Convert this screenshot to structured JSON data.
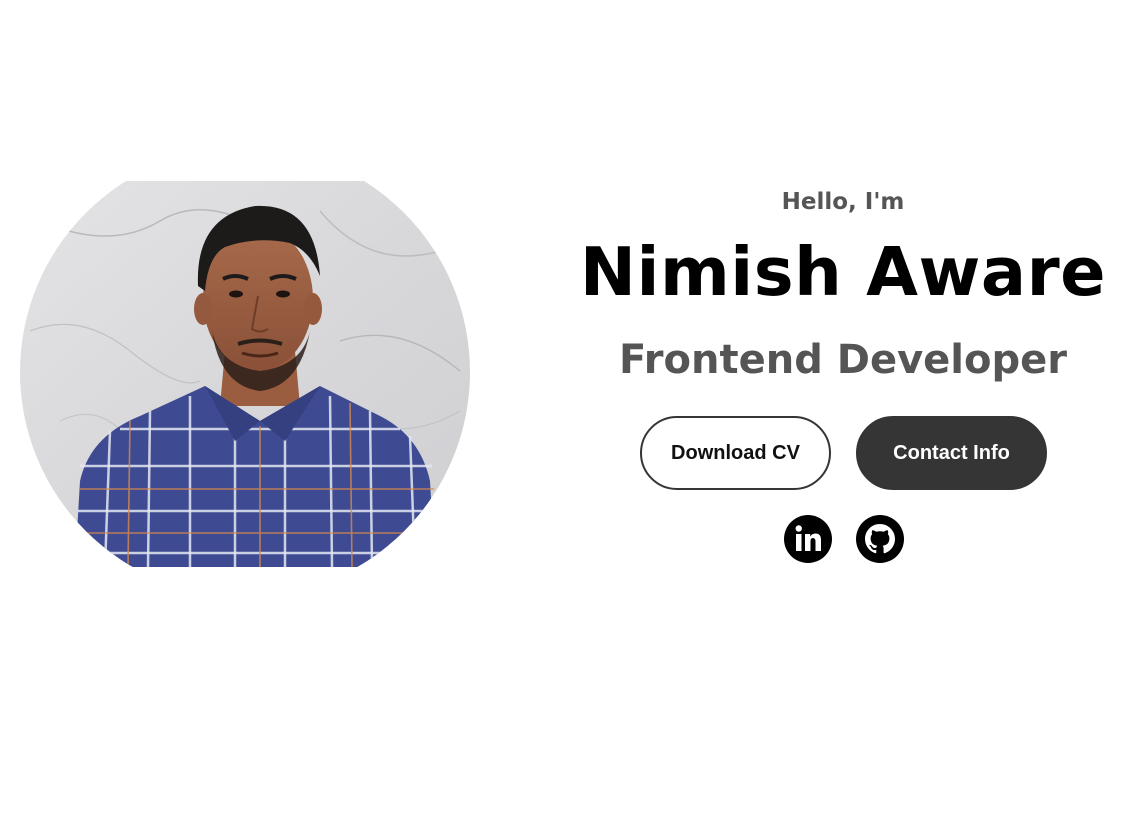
{
  "profile": {
    "image_alt": "profile picture"
  },
  "intro": {
    "greeting": "Hello, I'm",
    "name": "Nimish Aware",
    "title": "Frontend Developer"
  },
  "buttons": {
    "download_label": "Download CV",
    "contact_label": "Contact Info"
  },
  "socials": [
    {
      "icon": "linkedin-icon"
    },
    {
      "icon": "github-icon"
    }
  ],
  "colors": {
    "text_dark": "#000000",
    "text_muted": "#555555",
    "button_dark": "#353535",
    "background": "#ffffff"
  }
}
